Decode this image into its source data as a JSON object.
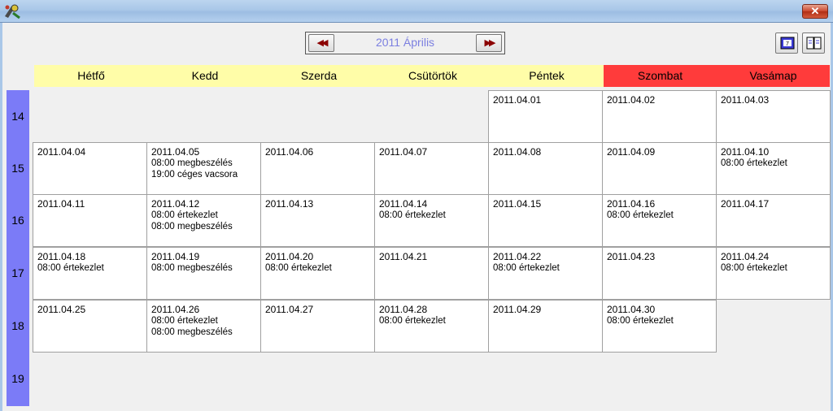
{
  "window": {
    "close_label": "✕"
  },
  "nav": {
    "prev_label": "◀◀",
    "next_label": "▶▶",
    "month": "2011 Április"
  },
  "toolbar": {
    "week_icon": "calendar-week-icon",
    "list_icon": "list-view-icon"
  },
  "days": [
    {
      "label": "Hétfő",
      "weekend": false
    },
    {
      "label": "Kedd",
      "weekend": false
    },
    {
      "label": "Szerda",
      "weekend": false
    },
    {
      "label": "Csütörtök",
      "weekend": false
    },
    {
      "label": "Péntek",
      "weekend": false
    },
    {
      "label": "Szombat",
      "weekend": true
    },
    {
      "label": "Vasámap",
      "weekend": true
    }
  ],
  "weeks": [
    {
      "number": "14",
      "cells": [
        null,
        null,
        null,
        null,
        {
          "date": "2011.04.01",
          "events": []
        },
        {
          "date": "2011.04.02",
          "events": []
        },
        {
          "date": "2011.04.03",
          "events": []
        }
      ]
    },
    {
      "number": "15",
      "cells": [
        {
          "date": "2011.04.04",
          "events": []
        },
        {
          "date": "2011.04.05",
          "events": [
            "08:00 megbeszélés",
            "19:00 céges vacsora"
          ]
        },
        {
          "date": "2011.04.06",
          "events": []
        },
        {
          "date": "2011.04.07",
          "events": []
        },
        {
          "date": "2011.04.08",
          "events": []
        },
        {
          "date": "2011.04.09",
          "events": []
        },
        {
          "date": "2011.04.10",
          "events": [
            "08:00 értekezlet"
          ]
        }
      ]
    },
    {
      "number": "16",
      "cells": [
        {
          "date": "2011.04.11",
          "events": []
        },
        {
          "date": "2011.04.12",
          "events": [
            "08:00 értekezlet",
            "08:00 megbeszélés"
          ]
        },
        {
          "date": "2011.04.13",
          "events": []
        },
        {
          "date": "2011.04.14",
          "events": [
            "08:00 értekezlet"
          ]
        },
        {
          "date": "2011.04.15",
          "events": []
        },
        {
          "date": "2011.04.16",
          "events": [
            "08:00 értekezlet"
          ]
        },
        {
          "date": "2011.04.17",
          "events": []
        }
      ]
    },
    {
      "number": "17",
      "cells": [
        {
          "date": "2011.04.18",
          "events": [
            "08:00 értekezlet"
          ]
        },
        {
          "date": "2011.04.19",
          "events": [
            "08:00 megbeszélés"
          ]
        },
        {
          "date": "2011.04.20",
          "events": [
            "08:00 értekezlet"
          ]
        },
        {
          "date": "2011.04.21",
          "events": []
        },
        {
          "date": "2011.04.22",
          "events": [
            "08:00 értekezlet"
          ]
        },
        {
          "date": "2011.04.23",
          "events": []
        },
        {
          "date": "2011.04.24",
          "events": [
            "08:00 értekezlet"
          ]
        }
      ]
    },
    {
      "number": "18",
      "cells": [
        {
          "date": "2011.04.25",
          "events": []
        },
        {
          "date": "2011.04.26",
          "events": [
            "08:00 értekezlet",
            "08:00 megbeszélés"
          ]
        },
        {
          "date": "2011.04.27",
          "events": []
        },
        {
          "date": "2011.04.28",
          "events": [
            "08:00 értekezlet"
          ]
        },
        {
          "date": "2011.04.29",
          "events": []
        },
        {
          "date": "2011.04.30",
          "events": [
            "08:00 értekezlet"
          ]
        },
        null
      ]
    },
    {
      "number": "19",
      "cells": [
        null,
        null,
        null,
        null,
        null,
        null,
        null
      ]
    }
  ],
  "colors": {
    "weekday_header": "#fffda8",
    "weekend_header": "#ff3b3b",
    "week_bar": "#7b7bf7",
    "month_label": "#7b7fe0"
  }
}
